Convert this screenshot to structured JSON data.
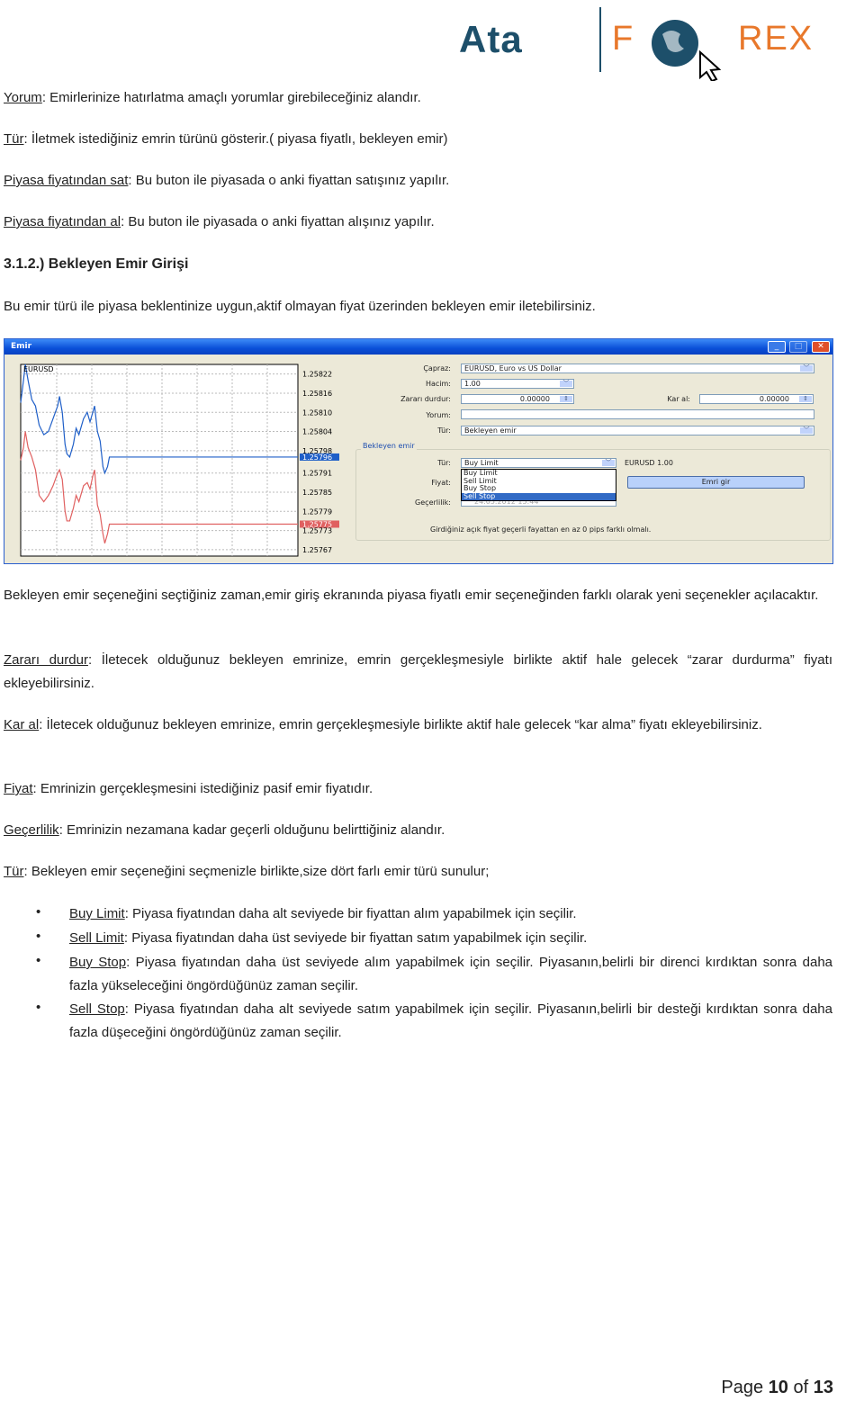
{
  "logo": {
    "left": "Ata",
    "right_pre": "F",
    "right_post": "REX",
    "colors": {
      "ata": "#1d4f6a",
      "forex": "#e8782b"
    }
  },
  "paras": [
    {
      "term": "Yorum",
      "text": ": Emirlerinize hatırlatma amaçlı yorumlar girebileceğiniz alandır."
    },
    {
      "term": "Tür",
      "text": ": İletmek istediğiniz emrin türünü gösterir.( piyasa fiyatlı, bekleyen emir)"
    },
    {
      "term": "Piyasa fiyatından sat",
      "text": ": Bu buton ile piyasada o anki fiyattan satışınız yapılır."
    },
    {
      "term": "Piyasa fiyatından al",
      "text": ": Bu buton ile piyasada o anki fiyattan alışınız yapılır."
    }
  ],
  "heading": "3.1.2.) Bekleyen Emir Girişi",
  "intro": "Bu emir türü ile piyasa beklentinize uygun,aktif olmayan fiyat üzerinden bekleyen emir iletebilirsiniz.",
  "screenshot": {
    "title": "Emir",
    "chart": {
      "symbol": "EURUSD",
      "ticks": [
        "1.25822",
        "1.25816",
        "1.25810",
        "1.25804",
        "1.25798",
        "1.25791",
        "1.25785",
        "1.25779",
        "1.25773",
        "1.25767"
      ],
      "ask_label": "1.25796",
      "bid_label": "1.25775",
      "colors": {
        "ask": "#1f5fc8",
        "bid": "#e06060"
      }
    },
    "form": {
      "capraz_label": "Çapraz:",
      "capraz_value": "EURUSD, Euro vs US Dollar",
      "hacim_label": "Hacim:",
      "hacim_value": "1.00",
      "zarar_label": "Zararı durdur:",
      "zarar_value": "0.00000",
      "kar_label": "Kar al:",
      "kar_value": "0.00000",
      "yorum_label": "Yorum:",
      "yorum_value": "",
      "tur_label": "Tür:",
      "tur_value": "Bekleyen emir",
      "group_label": "Bekleyen emir",
      "ptur_label": "Tür:",
      "ptur_value": "Buy Limit",
      "options": [
        "Buy Limit",
        "Sell Limit",
        "Buy Stop",
        "Sell Stop"
      ],
      "selected_option": "Sell Stop",
      "symbol_volume": "EURUSD 1.00",
      "fiyat_label": "Fiyat:",
      "gecerlilik_label": "Geçerlilik:",
      "gecerlilik_value": "24.05.2012 15:44",
      "submit": "Emri gir",
      "message": "Girdiğiniz açık fiyat geçerli fayattan en az 0 pips farklı olmalı."
    }
  },
  "chart_data": {
    "type": "line",
    "title": "EURUSD",
    "ylim": [
      1.25767,
      1.25825
    ],
    "grid": true,
    "x": [
      0,
      3,
      5,
      8,
      12,
      16,
      20,
      25,
      30,
      35,
      40,
      42,
      45,
      48,
      50,
      53,
      57,
      60,
      63,
      68,
      72,
      75,
      78,
      80,
      83,
      86,
      89,
      91,
      94,
      96,
      300
    ],
    "series": [
      {
        "values": [
          1.25813,
          1.2582,
          1.25825,
          1.2582,
          1.25814,
          1.25812,
          1.25806,
          1.25803,
          1.25804,
          1.25808,
          1.25812,
          1.25815,
          1.2581,
          1.258,
          1.25797,
          1.25796,
          1.258,
          1.25805,
          1.25803,
          1.25808,
          1.2581,
          1.25807,
          1.2581,
          1.25812,
          1.25804,
          1.25801,
          1.25793,
          1.25791,
          1.25793,
          1.25796,
          1.25796
        ]
      },
      {
        "values": [
          1.25795,
          1.25799,
          1.25804,
          1.25799,
          1.25796,
          1.25792,
          1.25784,
          1.25782,
          1.25784,
          1.25787,
          1.25791,
          1.25792,
          1.25789,
          1.25779,
          1.25776,
          1.25776,
          1.2578,
          1.25784,
          1.25782,
          1.25787,
          1.25788,
          1.25786,
          1.2579,
          1.25792,
          1.25781,
          1.25778,
          1.25772,
          1.25769,
          1.25772,
          1.25775,
          1.25775
        ]
      }
    ]
  },
  "after": "Bekleyen emir seçeneğini seçtiğiniz zaman,emir giriş ekranında piyasa fiyatlı emir seçeneğinden farklı olarak yeni seçenekler açılacaktır.",
  "paras2": [
    {
      "term": "Zararı durdur",
      "text": ": İletecek olduğunuz bekleyen emrinize, emrin gerçekleşmesiyle birlikte aktif hale gelecek “zarar durdurma” fiyatı ekleyebilirsiniz."
    },
    {
      "term": "Kar al",
      "text": ": İletecek olduğunuz bekleyen emrinize, emrin gerçekleşmesiyle birlikte aktif hale gelecek “kar alma” fiyatı ekleyebilirsiniz."
    },
    {
      "term": "Fiyat",
      "text": ": Emrinizin gerçekleşmesini istediğiniz pasif emir fiyatıdır."
    },
    {
      "term": "Geçerlilik",
      "text": ": Emrinizin nezamana kadar geçerli olduğunu belirttiğiniz alandır."
    },
    {
      "term": "Tür",
      "text": ": Bekleyen emir seçeneğini seçmenizle birlikte,size dört farlı emir türü sunulur;"
    }
  ],
  "bullets": [
    {
      "term": "Buy Limit",
      "text": ": Piyasa fiyatından daha alt seviyede bir fiyattan alım yapabilmek için seçilir."
    },
    {
      "term": "Sell Limit",
      "text": ": Piyasa fiyatından daha üst seviyede bir fiyattan satım yapabilmek için seçilir."
    },
    {
      "term": "Buy Stop",
      "text": ": Piyasa fiyatından daha üst seviyede alım yapabilmek için seçilir. Piyasanın,belirli bir direnci kırdıktan sonra daha fazla yükseleceğini öngördüğünüz zaman seçilir."
    },
    {
      "term": "Sell Stop",
      "text": ": Piyasa fiyatından daha alt seviyede satım yapabilmek için seçilir. Piyasanın,belirli bir desteği kırdıktan sonra daha fazla düşeceğini öngördüğünüz zaman seçilir."
    }
  ],
  "footer": {
    "page_word": "Page",
    "current": "10",
    "of_word": "of",
    "total": "13"
  }
}
